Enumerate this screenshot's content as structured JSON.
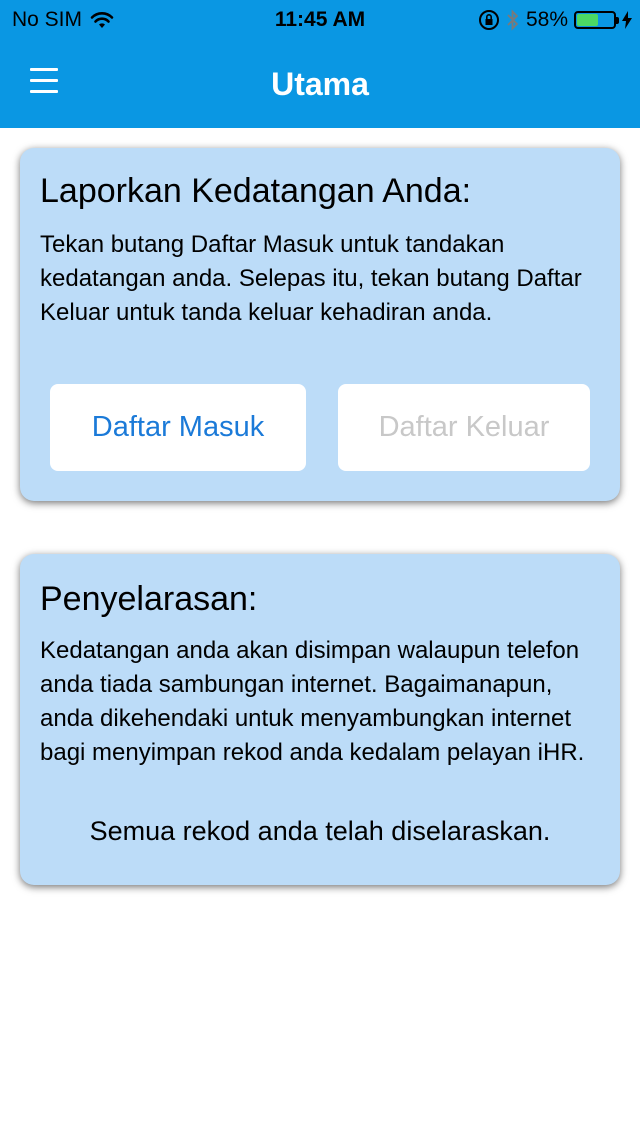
{
  "status_bar": {
    "carrier": "No SIM",
    "time": "11:45 AM",
    "battery_percent": "58%",
    "battery_level": 0.58,
    "battery_color": "#4cd964"
  },
  "nav": {
    "title": "Utama",
    "menu_icon": "hamburger-menu-icon",
    "background_color": "#0a97e3"
  },
  "attendance_card": {
    "title": "Laporkan Kedatangan Anda:",
    "description": "Tekan butang Daftar Masuk untuk tandakan kedatangan anda. Selepas itu, tekan butang Daftar Keluar untuk tanda keluar kehadiran anda.",
    "check_in_label": "Daftar Masuk",
    "check_out_label": "Daftar Keluar",
    "check_out_enabled": false
  },
  "sync_card": {
    "title": "Penyelarasan:",
    "description": "Kedatangan anda akan disimpan walaupun telefon anda tiada sambungan internet. Bagaimanapun, anda dikehendaki untuk menyambungkan internet bagi menyimpan rekod anda kedalam pelayan iHR.",
    "status": "Semua rekod anda telah diselaraskan."
  }
}
